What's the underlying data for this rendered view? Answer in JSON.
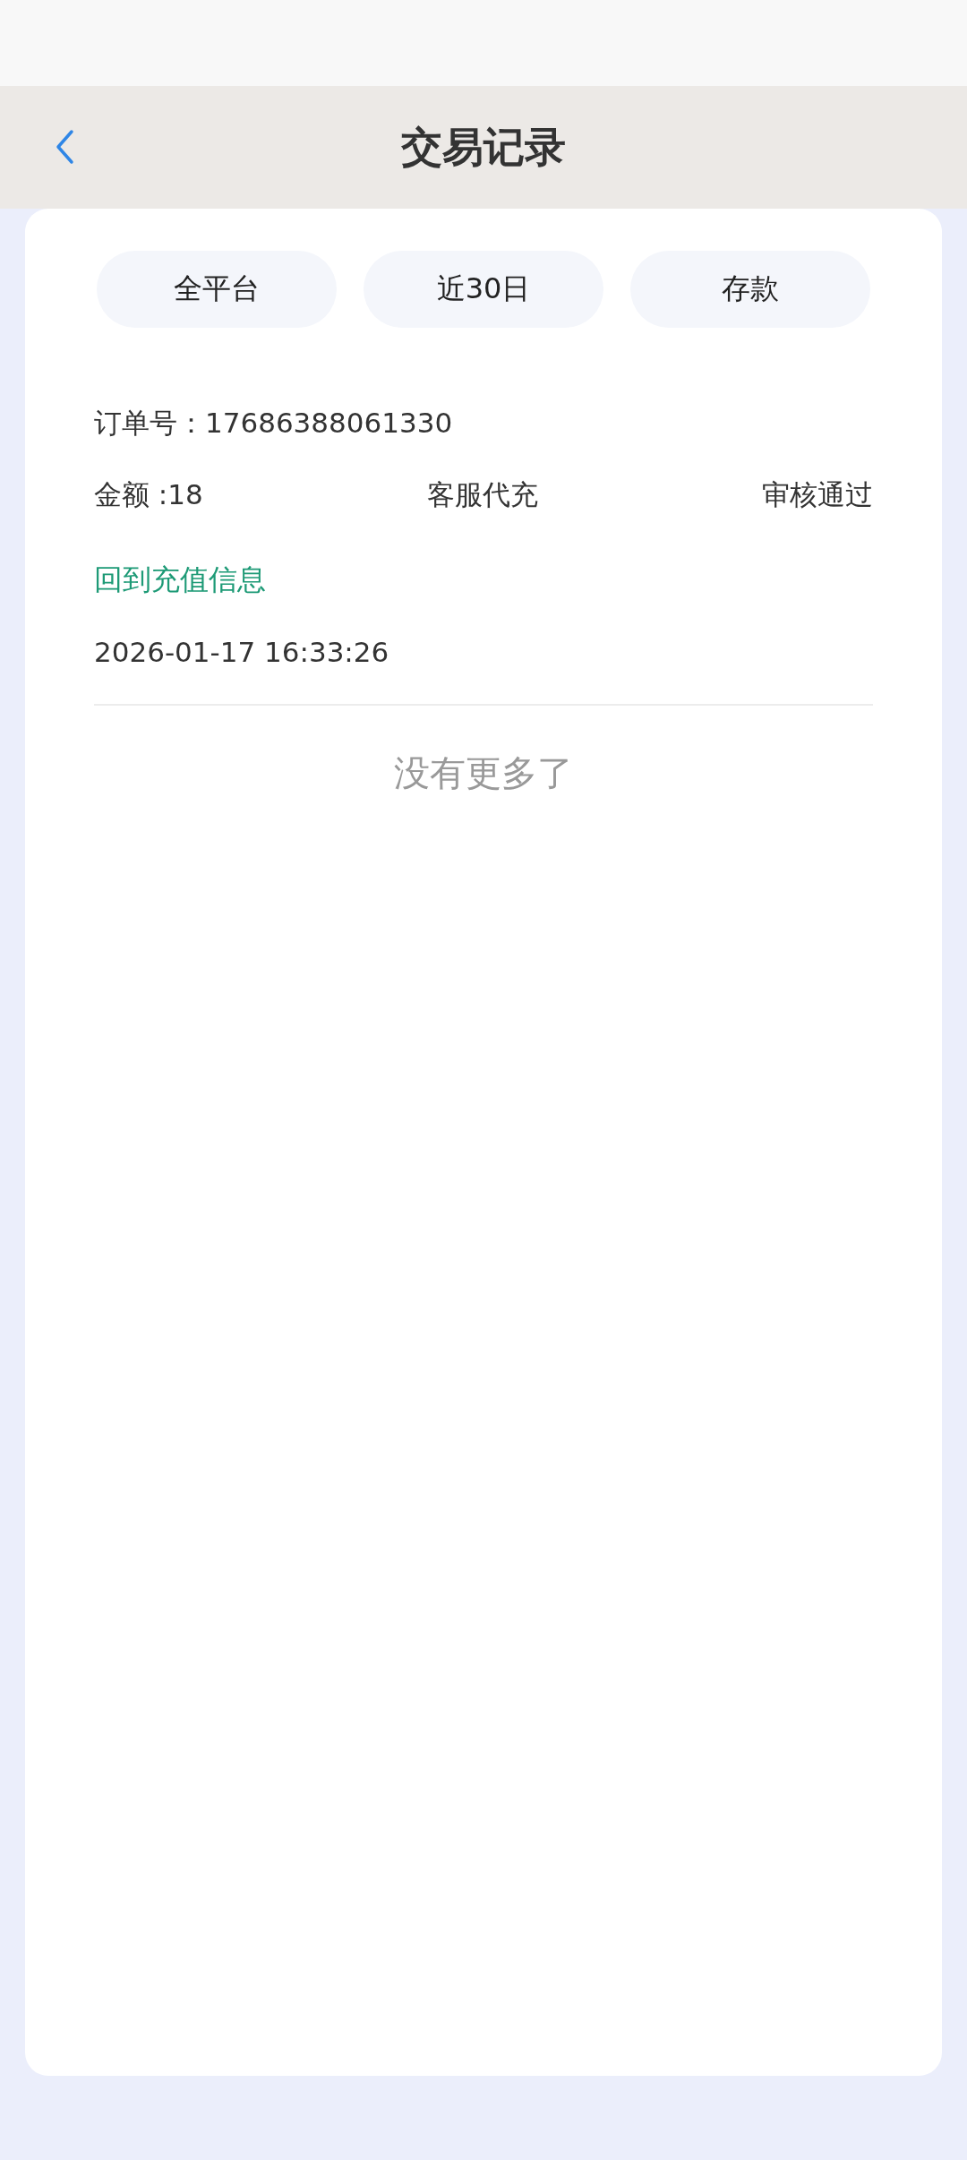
{
  "header": {
    "title": "交易记录"
  },
  "filters": [
    {
      "label": "全平台"
    },
    {
      "label": "近30日"
    },
    {
      "label": "存款"
    }
  ],
  "records": [
    {
      "order": "订单号：17686388061330",
      "amount": "金额 :18",
      "method": "客服代充",
      "status": "审核通过",
      "link": "回到充值信息",
      "time": "2026-01-17 16:33:26"
    }
  ],
  "end_note": "没有更多了"
}
